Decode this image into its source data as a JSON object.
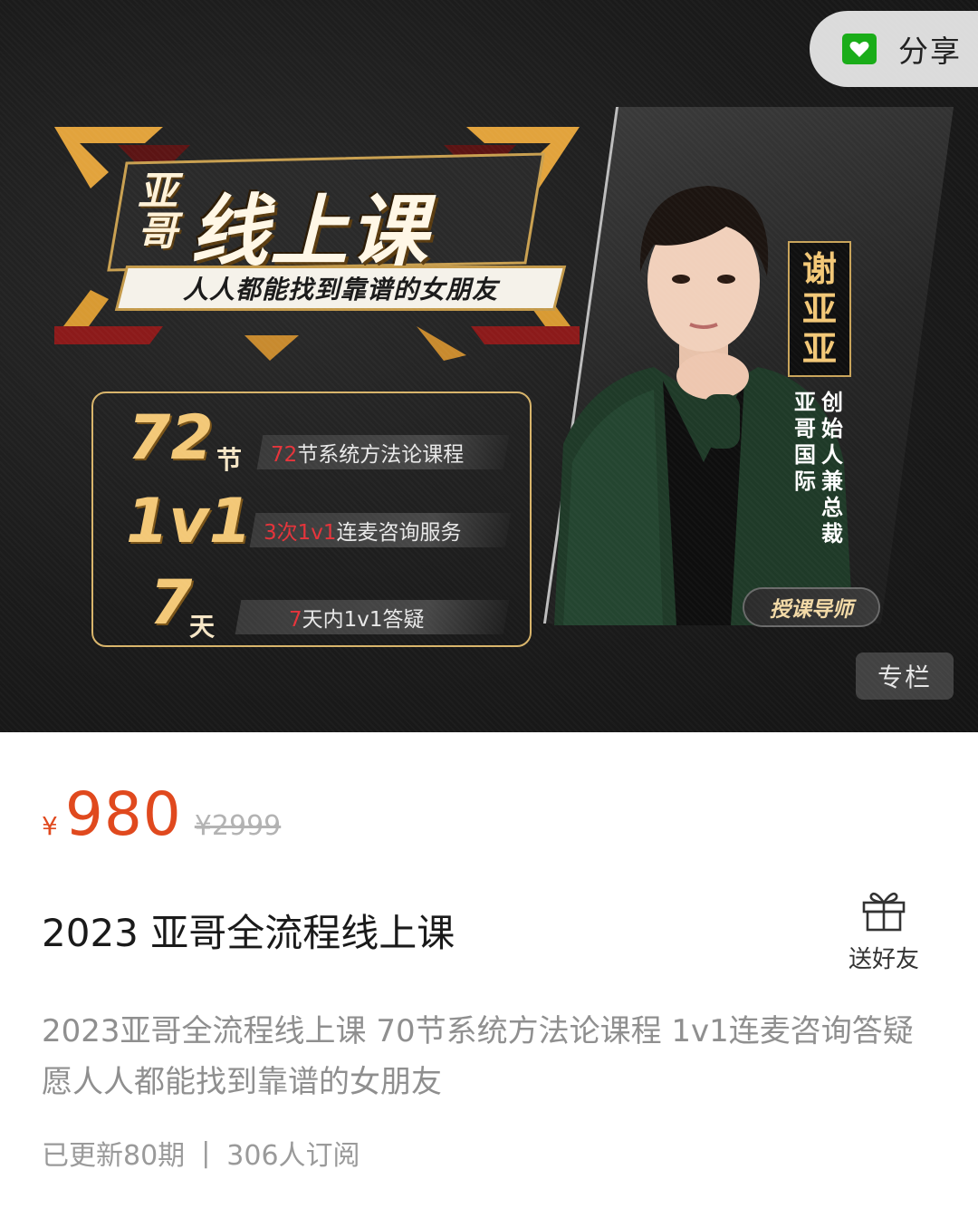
{
  "share": {
    "label": "分享"
  },
  "banner": {
    "title_side": "亚哥",
    "title_main": "线上课",
    "subtitle": "人人都能找到靠谱的女朋友",
    "features": [
      {
        "big": "72",
        "unit": "节",
        "red": "72",
        "text": "节系统方法论课程"
      },
      {
        "big": "1v1",
        "unit": "",
        "red": "3次1v1",
        "text": "连麦咨询服务"
      },
      {
        "big": "7",
        "unit": "天",
        "red": "7",
        "text": "天内1v1答疑"
      }
    ],
    "presenter_name": [
      "谢",
      "亚",
      "亚"
    ],
    "presenter_role_col1": "亚哥国际",
    "presenter_role_col2": "创始人兼总裁",
    "teacher_tag": "授课导师",
    "category_badge": "专栏"
  },
  "product": {
    "currency": "¥",
    "price": "980",
    "original_price": "¥2999",
    "title": "2023 亚哥全流程线上课",
    "gift_label": "送好友",
    "description": "2023亚哥全流程线上课 70节系统方法论课程 1v1连麦咨询答疑 愿人人都能找到靠谱的女朋友",
    "updated": "已更新80期",
    "separator": "|",
    "subscribers": "306人订阅"
  },
  "colors": {
    "price": "#e0491e",
    "gold": "#f3c877",
    "share_icon": "#1aad19"
  }
}
